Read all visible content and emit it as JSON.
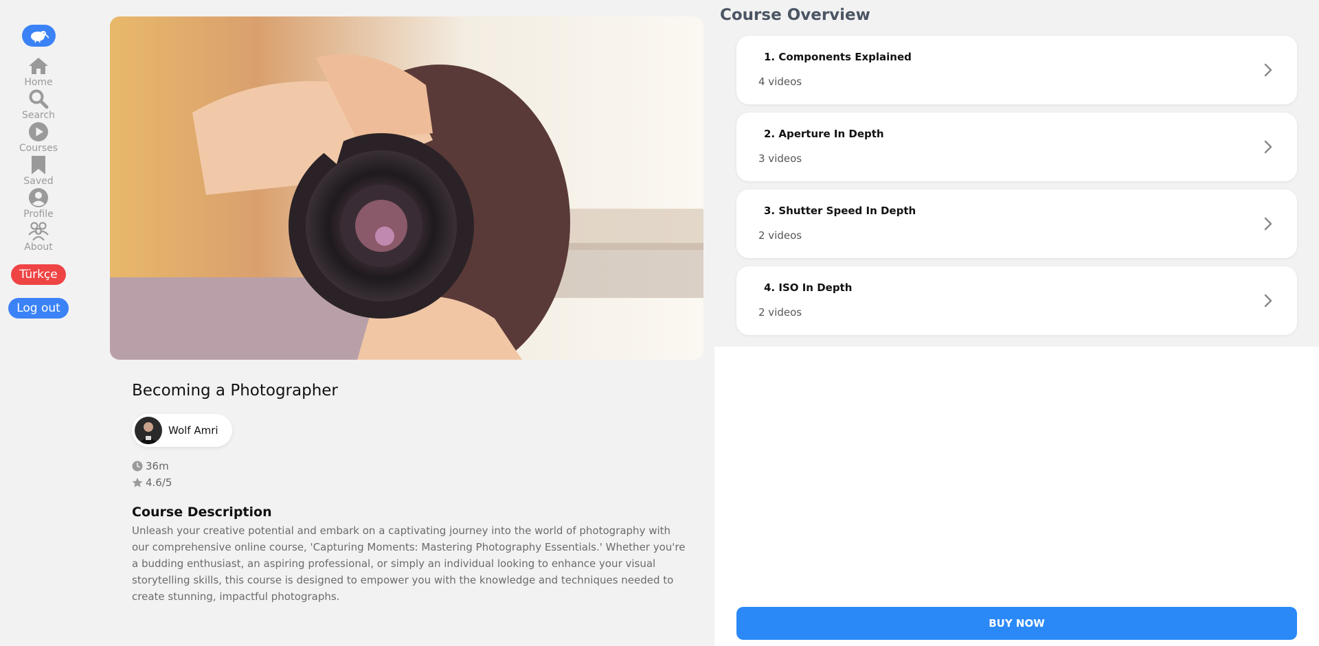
{
  "sidebar": {
    "logo_icon": "kiwi-bird-icon",
    "nav": [
      {
        "label": "Home",
        "icon": "home-icon"
      },
      {
        "label": "Search",
        "icon": "search-icon"
      },
      {
        "label": "Courses",
        "icon": "play-circle-icon"
      },
      {
        "label": "Saved",
        "icon": "bookmark-icon"
      },
      {
        "label": "Profile",
        "icon": "user-circle-icon"
      },
      {
        "label": "About",
        "icon": "users-icon"
      }
    ],
    "language_button": "Türkçe",
    "logout_button": "Log out"
  },
  "course": {
    "title": "Becoming a Photographer",
    "author": "Wolf Amri",
    "duration": "36m",
    "rating": "4.6/5",
    "description_title": "Course Description",
    "description": "Unleash your creative potential and embark on a captivating journey into the world of photography with our comprehensive online course, 'Capturing Moments: Mastering Photography Essentials.' Whether you're a budding enthusiast, an aspiring professional, or simply an individual looking to enhance your visual storytelling skills, this course is designed to empower you with the knowledge and techniques needed to create stunning, impactful photographs."
  },
  "overview": {
    "title": "Course Overview",
    "sections": [
      {
        "name": "1. Components Explained",
        "count": "4 videos"
      },
      {
        "name": "2. Aperture In Depth",
        "count": "3 videos"
      },
      {
        "name": "3. Shutter Speed In Depth",
        "count": "2 videos"
      },
      {
        "name": "4. ISO In Depth",
        "count": "2 videos"
      }
    ],
    "buy_button": "BUY NOW"
  },
  "colors": {
    "accent": "#3b82f6",
    "buy": "#2b89f7",
    "language": "#ef4444"
  }
}
